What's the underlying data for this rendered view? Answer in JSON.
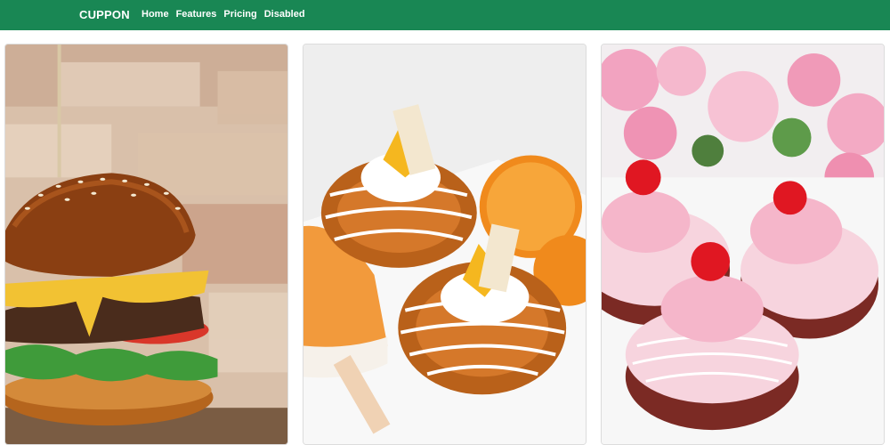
{
  "navbar": {
    "brand": "CUPPON",
    "links": [
      {
        "label": "Home"
      },
      {
        "label": "Features"
      },
      {
        "label": "Pricing"
      },
      {
        "label": "Disabled"
      }
    ],
    "color": "#198754"
  },
  "cards": [
    {
      "image": "burger-photo"
    },
    {
      "image": "orange-donuts-photo"
    },
    {
      "image": "pink-donuts-photo"
    }
  ]
}
